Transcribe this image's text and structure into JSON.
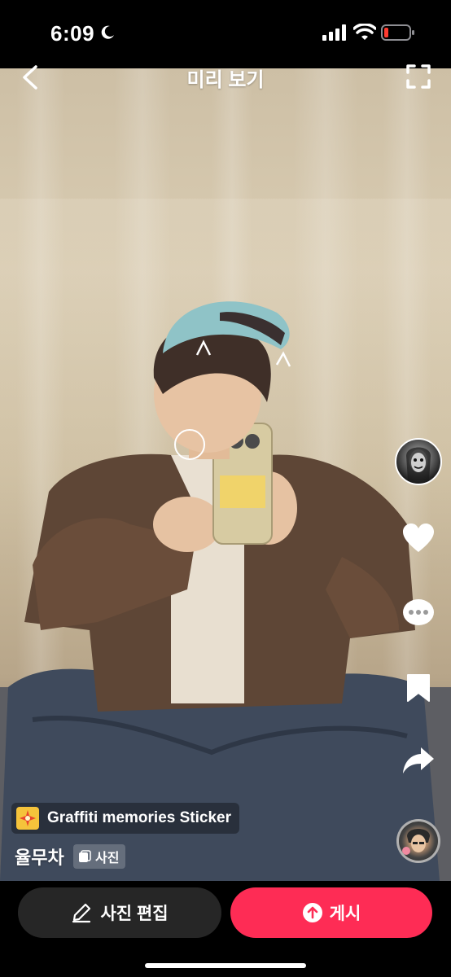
{
  "status_bar": {
    "time": "6:09",
    "icons": [
      "moon-icon",
      "cellular-signal-icon",
      "wifi-icon",
      "battery-low-icon"
    ],
    "battery_color": "#ff3b30"
  },
  "header": {
    "title": "미리 보기",
    "back_icon": "chevron-left-icon",
    "fullscreen_icon": "fullscreen-icon"
  },
  "right_rail": {
    "icons": [
      "creator-avatar",
      "heart-icon",
      "more-icon",
      "bookmark-icon",
      "share-icon",
      "music-disc"
    ]
  },
  "caption": {
    "sticker_label": "Graffiti memories Sticker",
    "sticker_icon": "sparkle-sticker-icon",
    "username": "율무차",
    "badge_label": "사진"
  },
  "bottom_bar": {
    "edit_label": "사진 편집",
    "edit_icon": "pencil-icon",
    "post_label": "게시",
    "post_icon": "upload-arrow-icon",
    "post_color": "#fe2c55"
  }
}
